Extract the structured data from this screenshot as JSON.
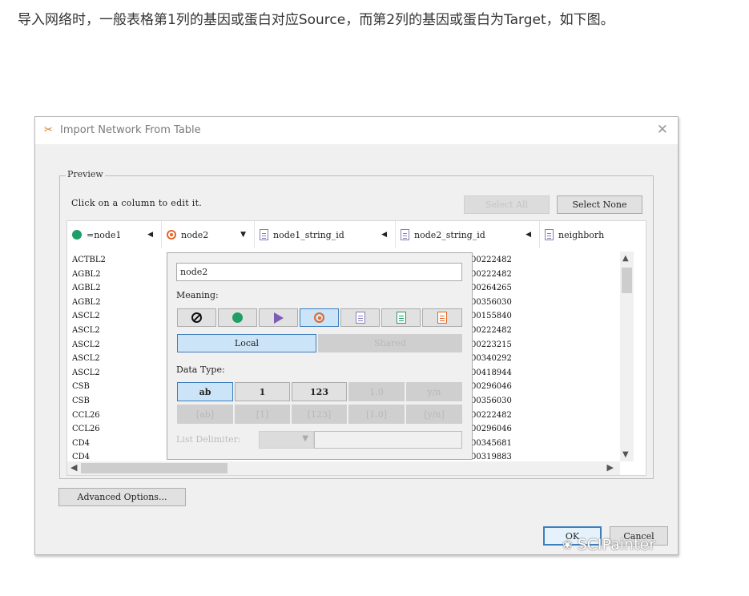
{
  "article": {
    "paragraph": "导入网络时，一般表格第1列的基因或蛋白对应Source，而第2列的基因或蛋白为Target，如下图。"
  },
  "dialog": {
    "title": "Import Network From Table",
    "close_symbol": "✕",
    "preview_label": "Preview",
    "hint": "Click on a column to edit it.",
    "select_all_label": "Select All",
    "select_none_label": "Select None",
    "advanced_options_label": "Advanced Options...",
    "ok_label": "OK",
    "cancel_label": "Cancel"
  },
  "table": {
    "columns": [
      {
        "label": "=node1"
      },
      {
        "label": "node2"
      },
      {
        "label": "node1_string_id"
      },
      {
        "label": "node2_string_id"
      },
      {
        "label": "neighborh"
      }
    ],
    "node1_values": [
      "ACTBL2",
      "AGBL2",
      "AGBL2",
      "AGBL2",
      "ASCL2",
      "ASCL2",
      "ASCL2",
      "ASCL2",
      "ASCL2",
      "CSB",
      "CSB",
      "CCL26",
      "CCL26",
      "CD4",
      "CD4"
    ],
    "node2_string_values": [
      "00222482",
      "00222482",
      "00264265",
      "00356030",
      "00155840",
      "00222482",
      "00223215",
      "00340292",
      "00418944",
      "00296046",
      "00356030",
      "00222482",
      "00296046",
      "00345681",
      "00319883"
    ]
  },
  "editor": {
    "column_name": "node2",
    "meaning_label": "Meaning:",
    "local_label": "Local",
    "shared_label": "Shared",
    "data_type_label": "Data Type:",
    "types_row1": [
      "ab",
      "1",
      "123",
      "1.0",
      "y/n"
    ],
    "types_row2": [
      "[ab]",
      "[1]",
      "[123]",
      "[1.0]",
      "[y/n]"
    ],
    "list_delimiter_label": "List Delimiter:"
  },
  "watermark": {
    "text": "SCIPainter"
  },
  "colors": {
    "source_green": "#1f9e66",
    "target_orange": "#e2672a",
    "interaction_purple": "#7d5cb8",
    "selected_blue": "#cce4f7"
  },
  "icons": {
    "meaning": [
      "none-icon",
      "source-node-icon",
      "interaction-icon",
      "target-node-icon",
      "source-attr-icon",
      "edge-attr-icon",
      "target-attr-icon"
    ]
  }
}
